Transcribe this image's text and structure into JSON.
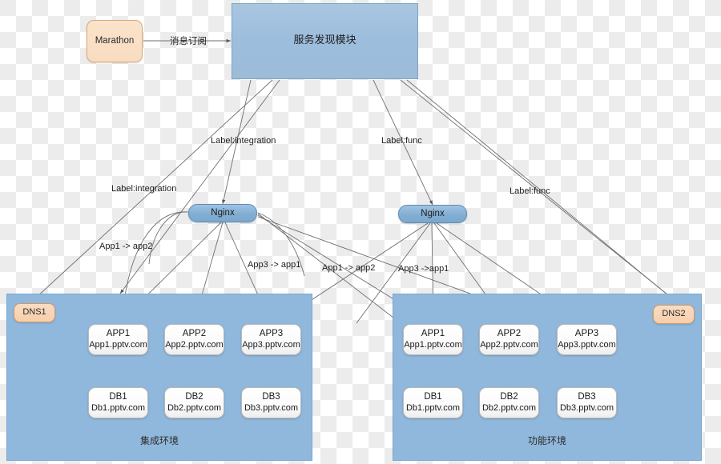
{
  "diagram": {
    "title": "服务发现模块",
    "nodes": {
      "marathon": {
        "label": "Marathon"
      },
      "discovery": {
        "label": "服务发现模块"
      },
      "nginx_left": {
        "label": "Nginx"
      },
      "nginx_right": {
        "label": "Nginx"
      },
      "dns1": {
        "label": "DNS1"
      },
      "dns2": {
        "label": "DNS2"
      }
    },
    "edge_labels": {
      "subscribe": "消息订阅",
      "label_integration_mid": "Label:integration",
      "label_integration_left": "Label:integration",
      "label_func_mid": "Label:func",
      "label_func_right": "Label:func",
      "left_app1_app2": "App1  -> app2",
      "left_app3_app1": "App3 -> app1",
      "right_app1_app2": "App1 -> app2",
      "right_app3_app1": "App3 ->app1"
    },
    "environments": [
      {
        "id": "integration",
        "name": "集成环境",
        "dns": "DNS1",
        "apps": [
          {
            "title": "APP1",
            "host": "App1.pptv.com"
          },
          {
            "title": "APP2",
            "host": "App2.pptv.com"
          },
          {
            "title": "APP3",
            "host": "App3.pptv.com"
          }
        ],
        "dbs": [
          {
            "title": "DB1",
            "host": "Db1.pptv.com"
          },
          {
            "title": "DB2",
            "host": "Db2.pptv.com"
          },
          {
            "title": "DB3",
            "host": "Db3.pptv.com"
          }
        ]
      },
      {
        "id": "function",
        "name": "功能环境",
        "dns": "DNS2",
        "apps": [
          {
            "title": "APP1",
            "host": "App1.pptv.com"
          },
          {
            "title": "APP2",
            "host": "App2.pptv.com"
          },
          {
            "title": "APP3",
            "host": "App3.pptv.com"
          }
        ],
        "dbs": [
          {
            "title": "DB1",
            "host": "Db1.pptv.com"
          },
          {
            "title": "DB2",
            "host": "Db2.pptv.com"
          },
          {
            "title": "DB3",
            "host": "Db3.pptv.com"
          }
        ]
      }
    ],
    "colors": {
      "panel_fill": "#90b8dc",
      "discovery_fill": "#9cbddd",
      "nginx_fill": "#82aed3",
      "dns_fill": "#f6cfac",
      "card_fill": "#ffffff",
      "edge_stroke": "#6f6f6f"
    }
  }
}
